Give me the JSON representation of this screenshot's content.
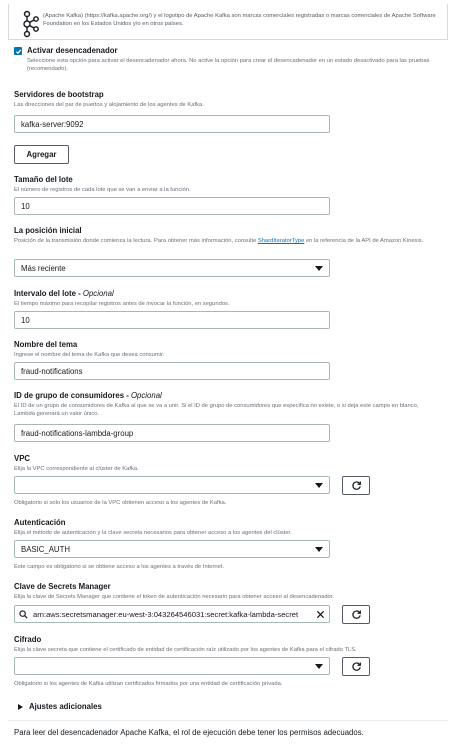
{
  "kafka_notice": "(Apache Kafka) (https://kafka.apache.org/) y el logotipo de Apache Kafka son marcas comerciales registradas o marcas comerciales de Apache Software Foundation en los Estados Unidos y/o en otros países.",
  "activate": {
    "label": "Activar desencadenador",
    "checked": true,
    "description": "Seleccione esta opción para activar el desencadenador ahora. No active la opción para crear el desencadenador en un estado desactivado para las pruebas (recomendado)."
  },
  "bootstrap": {
    "label": "Servidores de bootstrap",
    "description": "Las direcciones del par de puertos y alojamiento de los agentes de Kafka.",
    "value": "kafka-server:9092",
    "add_button": "Agregar"
  },
  "batch_size": {
    "label": "Tamaño del lote",
    "description": "El número de registros de cada lote que se van a enviar a la función.",
    "value": "10"
  },
  "start_position": {
    "label": "La posición inicial",
    "description_before": "Posición de la transmisión donde comienza la lectura. Para obtener más información, consulte ",
    "link": "ShardIteratorType",
    "description_after": " en la referencia de la API de Amazon Kinesis.",
    "value": "Más reciente"
  },
  "batch_window": {
    "label": "Intervalo del lote",
    "optional": "Opcional",
    "description": "El tiempo máximo para recopilar registros antes de invocar la función, en segundos.",
    "value": "10"
  },
  "topic": {
    "label": "Nombre del tema",
    "description": "Ingrese el nombre del tema de Kafka que desea consumir.",
    "value": "fraud-notifications"
  },
  "consumer_group": {
    "label": "ID de grupo de consumidores",
    "optional": "Opcional",
    "description": "El ID de un grupo de consumidores de Kafka al que se va a unir. Si el ID de grupo de consumidores que especifica no existe, o si deja este campo en blanco, Lambda generará un valor único.",
    "value": "fraud-notifications-lambda-group"
  },
  "vpc": {
    "label": "VPC",
    "description": "Elija la VPC correspondiente al clúster de Kafka.",
    "value": "",
    "help": "Obligatorio si solo los usuarios de la VPC obtienen acceso a los agentes de Kafka."
  },
  "auth": {
    "label": "Autenticación",
    "description": "Elija el método de autenticación y la clave secreta necesarios para obtener acceso a los agentes del clúster.",
    "value": "BASIC_AUTH",
    "help": "Este campo es obligatorio si se obtiene acceso a los agentes a través de Internet."
  },
  "secret": {
    "label": "Clave de Secrets Manager",
    "description": "Elija la clave de Secrets Manager que contiene el token de autenticación necesario para obtener acceso al desencadenador.",
    "value": "arn:aws:secretsmanager:eu-west-3:043264546031:secret:kafka-lambda-secret"
  },
  "encryption": {
    "label": "Cifrado",
    "description": "Elija la clave secreta que contiene el certificado de entidad de certificación raíz utilizado por los agentes de Kafka para el cifrado TLS.",
    "value": "",
    "help": "Obligatorio si los agentes de Kafka utilizan certificados firmados por una entidad de certificación privada."
  },
  "additional_settings": "Ajustes adicionales",
  "footer": "Para leer del desencadenador Apache Kafka, el rol de ejecución debe tener los permisos adecuados.",
  "colors": {
    "accent": "#0073bb",
    "border": "#aab7b8",
    "text": "#16191f",
    "muted": "#687078"
  },
  "icons": [
    "kafka-logo-icon",
    "check-icon",
    "caret-down-icon",
    "refresh-icon",
    "search-icon",
    "clear-icon",
    "expand-triangle-icon"
  ]
}
